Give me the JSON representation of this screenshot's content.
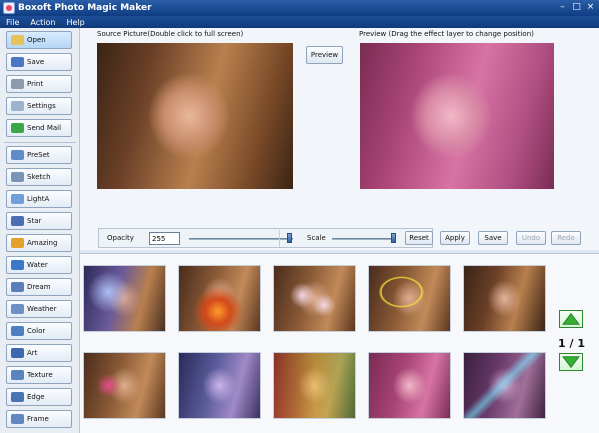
{
  "window": {
    "title": "Boxoft Photo Magic Maker",
    "controls": [
      "–",
      "□",
      "×"
    ]
  },
  "menu": [
    "File",
    "Action",
    "Help"
  ],
  "sidebar": {
    "top_buttons": [
      {
        "label": "Open",
        "icon": "folder-icon",
        "active": true
      },
      {
        "label": "Save",
        "icon": "save-icon"
      },
      {
        "label": "Print",
        "icon": "printer-icon"
      },
      {
        "label": "Settings",
        "icon": "settings-icon"
      },
      {
        "label": "Send Mail",
        "icon": "send-mail-icon"
      }
    ],
    "effects": [
      {
        "label": "PreSet",
        "icon": "preset-icon"
      },
      {
        "label": "Sketch",
        "icon": "sketch-icon"
      },
      {
        "label": "LightA",
        "icon": "light-icon"
      },
      {
        "label": "Star",
        "icon": "star-icon"
      },
      {
        "label": "Amazing",
        "icon": "amazing-icon"
      },
      {
        "label": "Water",
        "icon": "water-icon"
      },
      {
        "label": "Dream",
        "icon": "dream-icon"
      },
      {
        "label": "Weather",
        "icon": "weather-icon"
      },
      {
        "label": "Color",
        "icon": "color-icon"
      },
      {
        "label": "Art",
        "icon": "art-icon"
      },
      {
        "label": "Texture",
        "icon": "texture-icon"
      },
      {
        "label": "Edge",
        "icon": "edge-icon"
      },
      {
        "label": "Frame",
        "icon": "frame-icon"
      }
    ]
  },
  "source": {
    "label": "Source Picture(Double click to full screen)"
  },
  "preview": {
    "label": "Preview (Drag the effect layer to change position)",
    "button": "Preview"
  },
  "controls": {
    "opacity_label": "Opacity",
    "opacity_value": "255",
    "scale_label": "Scale",
    "reset": "Reset",
    "apply": "Apply",
    "save": "Save",
    "undo": "Undo",
    "redo": "Redo"
  },
  "gallery": {
    "page": "1 / 1",
    "thumbnails": [
      "effect-thumbnail",
      "effect-thumbnail",
      "effect-thumbnail",
      "effect-thumbnail",
      "effect-thumbnail",
      "effect-thumbnail",
      "effect-thumbnail",
      "effect-thumbnail",
      "effect-thumbnail",
      "effect-thumbnail"
    ]
  },
  "colors": {
    "titlebar": "#1f4f99",
    "preview_tint": "#c0407a",
    "nav_green": "#2c8a2c"
  }
}
